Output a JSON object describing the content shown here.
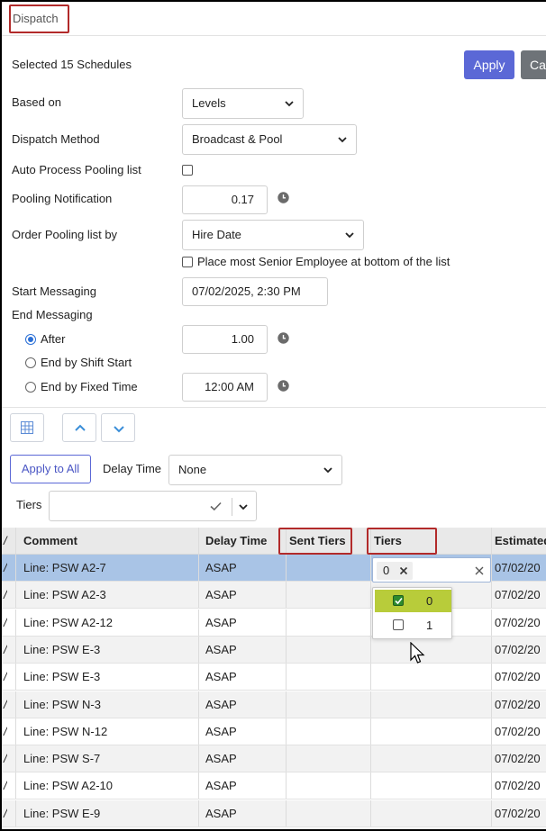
{
  "header": {
    "title": "Dispatch"
  },
  "summary": {
    "selected_text": "Selected 15 Schedules"
  },
  "buttons": {
    "apply": "Apply",
    "cancel_partial": "Ca"
  },
  "form": {
    "based_on": {
      "label": "Based on",
      "value": "Levels"
    },
    "dispatch_method": {
      "label": "Dispatch Method",
      "value": "Broadcast & Pool"
    },
    "auto_process": {
      "label": "Auto Process Pooling list",
      "checked": false
    },
    "pooling_notification": {
      "label": "Pooling Notification",
      "value": "0.17"
    },
    "order_pooling": {
      "label": "Order Pooling list by",
      "value": "Hire Date"
    },
    "senior_bottom": {
      "label": "Place most Senior Employee at bottom of the list",
      "checked": false
    },
    "start_messaging": {
      "label": "Start Messaging",
      "value": "07/02/2025, 2:30 PM"
    },
    "end_messaging": {
      "label": "End Messaging",
      "options": [
        {
          "label": "After",
          "selected": true,
          "value": "1.00"
        },
        {
          "label": "End by Shift Start",
          "selected": false
        },
        {
          "label": "End by Fixed Time",
          "selected": false,
          "value": "12:00 AM"
        }
      ]
    }
  },
  "toolbar": {
    "apply_to_all": "Apply to All",
    "delay_time_label": "Delay Time",
    "delay_time_value": "None",
    "tiers_label": "Tiers"
  },
  "table": {
    "columns": [
      "Comment",
      "Delay Time",
      "Sent Tiers",
      "Tiers",
      "Estimated"
    ],
    "rows": [
      {
        "comment": "Line: PSW A2-7",
        "delay": "ASAP",
        "sent": "",
        "tiers": "0",
        "estimated": "07/02/20"
      },
      {
        "comment": "Line: PSW A2-3",
        "delay": "ASAP",
        "sent": "",
        "tiers": "",
        "estimated": "07/02/20"
      },
      {
        "comment": "Line: PSW A2-12",
        "delay": "ASAP",
        "sent": "",
        "tiers": "",
        "estimated": "07/02/20"
      },
      {
        "comment": "Line: PSW E-3",
        "delay": "ASAP",
        "sent": "",
        "tiers": "",
        "estimated": "07/02/20"
      },
      {
        "comment": "Line: PSW E-3",
        "delay": "ASAP",
        "sent": "",
        "tiers": "",
        "estimated": "07/02/20"
      },
      {
        "comment": "Line: PSW N-3",
        "delay": "ASAP",
        "sent": "",
        "tiers": "",
        "estimated": "07/02/20"
      },
      {
        "comment": "Line: PSW N-12",
        "delay": "ASAP",
        "sent": "",
        "tiers": "",
        "estimated": "07/02/20"
      },
      {
        "comment": "Line: PSW S-7",
        "delay": "ASAP",
        "sent": "",
        "tiers": "",
        "estimated": "07/02/20"
      },
      {
        "comment": "Line: PSW A2-10",
        "delay": "ASAP",
        "sent": "",
        "tiers": "",
        "estimated": "07/02/20"
      },
      {
        "comment": "Line: PSW E-9",
        "delay": "ASAP",
        "sent": "",
        "tiers": "",
        "estimated": "07/02/20"
      }
    ]
  },
  "tiers_dropdown": {
    "options": [
      {
        "label": "0",
        "checked": true
      },
      {
        "label": "1",
        "checked": false
      }
    ]
  },
  "colors": {
    "primary": "#5b68d6",
    "selected_row": "#a9c4e6",
    "highlight_option": "#b8cc3a",
    "annotation": "#b22a2a",
    "radio_accent": "#2a6fd6"
  }
}
